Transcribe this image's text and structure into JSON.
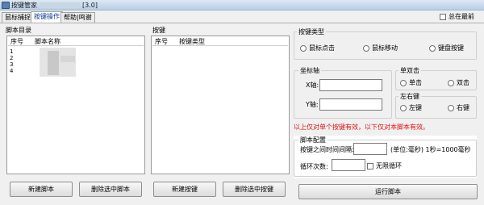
{
  "window": {
    "title": "按键管家",
    "version": "[3.0]"
  },
  "tabs": [
    {
      "label": "鼠标捕捉",
      "active": false
    },
    {
      "label": "按键操作",
      "active": true
    },
    {
      "label": "帮助|鸣谢",
      "active": false
    }
  ],
  "always_on_top": {
    "label": "总在最前",
    "checked": false
  },
  "script_panel": {
    "label": "脚本目录",
    "columns": [
      "序号",
      "脚本名称"
    ],
    "rows": [
      "1",
      "2",
      "3",
      "4"
    ],
    "new_button": "新建脚本",
    "delete_button": "删除选中脚本"
  },
  "key_panel": {
    "label": "按键",
    "columns": [
      "序号",
      "按键类型"
    ],
    "new_button": "新建按键",
    "delete_button": "删除选中按键"
  },
  "key_type": {
    "title": "按键类型",
    "options": [
      "鼠标点击",
      "鼠标移动",
      "键盘按键"
    ]
  },
  "coords": {
    "title": "坐标轴",
    "x_label": "X轴:",
    "y_label": "Y轴:",
    "x_value": "",
    "y_value": ""
  },
  "click_mode": {
    "title": "单双击",
    "single": "单击",
    "double": "双击"
  },
  "lr": {
    "title": "左右键",
    "left": "左键",
    "right": "右键"
  },
  "note": "以上仅对单个按键有效，以下仅对本脚本有效。",
  "script_config": {
    "title": "脚本配置",
    "interval_label": "按键之间时间间隔:",
    "interval_value": "",
    "unit_label": "(单位:毫秒) 1秒=1000毫秒",
    "loop_label": "循环次数:",
    "loop_value": "",
    "infinite_label": "无限循环",
    "infinite_checked": false
  },
  "run_button": "运行脚本",
  "colors": {
    "note": "#e01010",
    "active_tab": "#0a3a8e"
  }
}
